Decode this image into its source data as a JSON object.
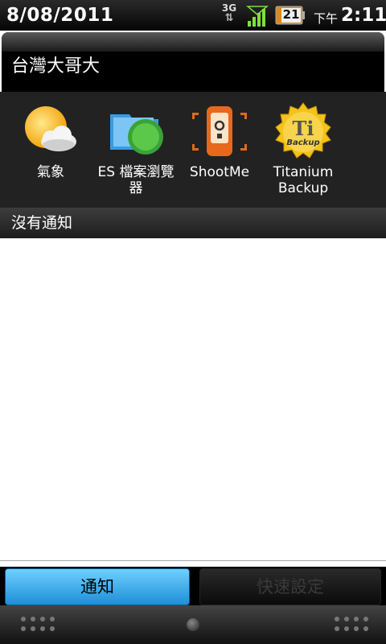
{
  "status_bar": {
    "date": "8/08/2011",
    "network": "3G",
    "battery_level": "21",
    "ampm": "下午",
    "time": "2:11"
  },
  "carrier": {
    "name": "台灣大哥大"
  },
  "shortcuts": [
    {
      "label": "氣象",
      "icon": "weather-icon"
    },
    {
      "label": "ES 檔案瀏覽器",
      "icon": "es-file-explorer-icon"
    },
    {
      "label": "ShootMe",
      "icon": "shootme-icon"
    },
    {
      "label": "Titanium Backup",
      "icon": "titanium-backup-icon",
      "badge": "Ti",
      "badge_sub": "Backup"
    }
  ],
  "notifications": {
    "empty_label": "沒有通知"
  },
  "tabs": {
    "notifications": "通知",
    "quick_settings": "快速設定"
  },
  "colors": {
    "active_tab": "#1d8fd8",
    "status_bar": "#050505",
    "shortcut_bg": "#222222"
  }
}
